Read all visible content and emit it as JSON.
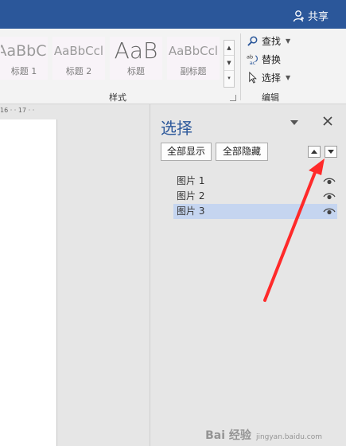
{
  "titlebar": {
    "share_label": "共享",
    "bg": "#2b579a"
  },
  "styles_gallery": {
    "tiles": [
      {
        "preview": "AaBbC",
        "name": "标题 1"
      },
      {
        "preview": "AaBbCcl",
        "name": "标题 2"
      },
      {
        "preview": "AaB",
        "name": "标题"
      },
      {
        "preview": "AaBbCcl",
        "name": "副标题"
      }
    ],
    "group_label": "样式"
  },
  "editing": {
    "find_label": "查找",
    "replace_label": "替换",
    "select_label": "选择",
    "group_label": "编辑"
  },
  "ruler": {
    "text": "16 · · 17 · ·"
  },
  "selection_pane": {
    "title": "选择",
    "show_all_label": "全部显示",
    "hide_all_label": "全部隐藏",
    "items": [
      {
        "label": "图片 1",
        "selected": false
      },
      {
        "label": "图片 2",
        "selected": false
      },
      {
        "label": "图片 3",
        "selected": true
      }
    ],
    "accent": "#2b579a",
    "selected_bg": "#c5d5f0"
  },
  "annotation": {
    "arrow_color": "#ff2a2a"
  },
  "watermark": {
    "brand": "Bai 经验",
    "domain": "jingyan.baidu.com"
  }
}
